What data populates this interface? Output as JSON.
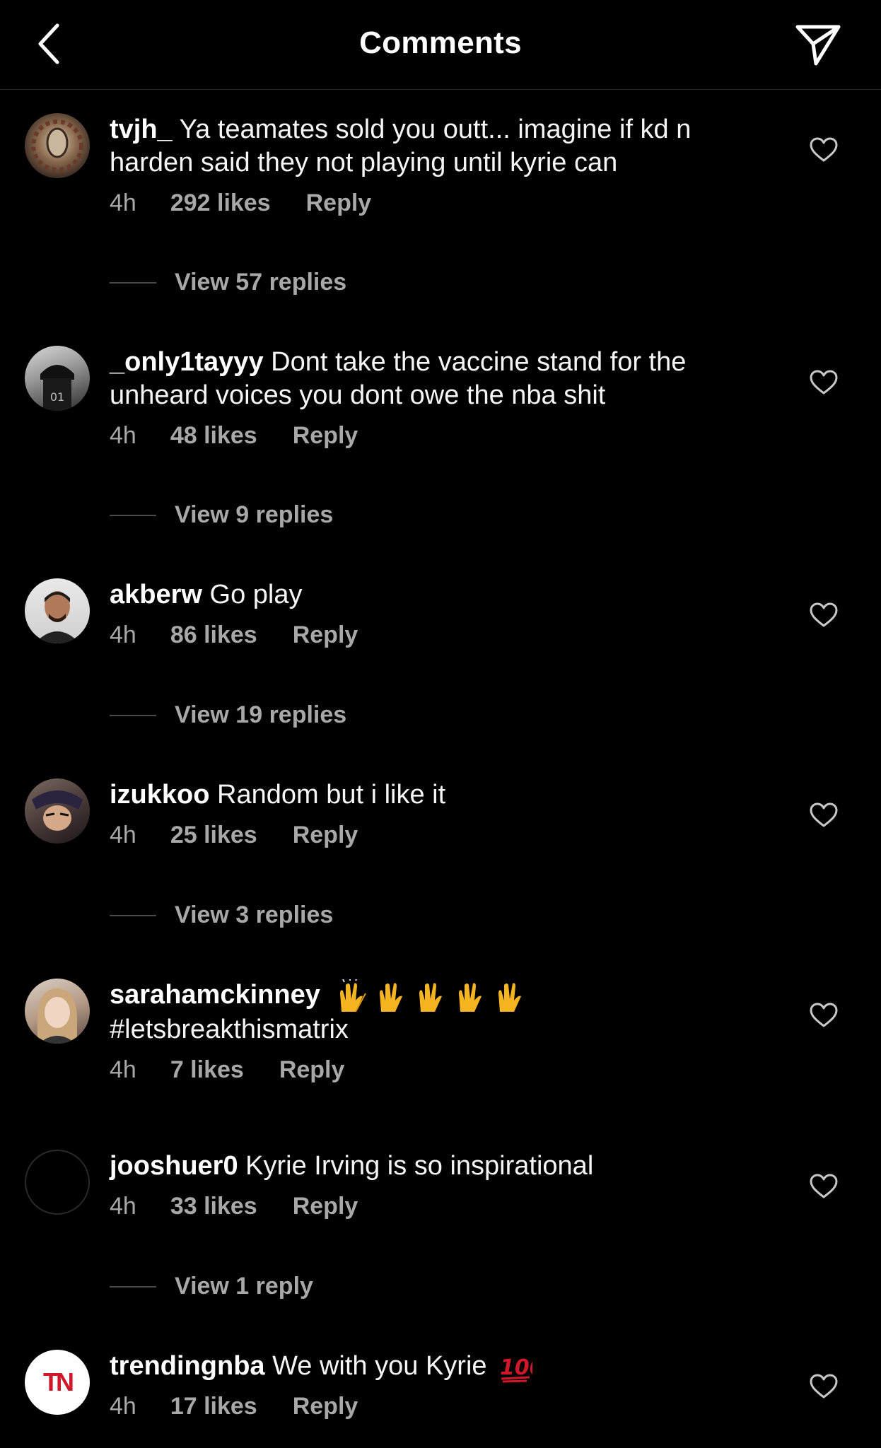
{
  "header": {
    "title": "Comments",
    "back_icon": "chevron-left-icon",
    "share_icon": "paper-plane-icon"
  },
  "colors": {
    "background": "#000000",
    "text": "#f5f5f5",
    "muted": "#a8a8a8",
    "hundred_red": "#d0182a"
  },
  "comments": [
    {
      "username": "tvjh_",
      "text": "Ya teamates sold you outt... imagine if kd n harden said they not playing until kyrie can",
      "time": "4h",
      "likes": "292 likes",
      "reply": "Reply",
      "view_replies": "View 57 replies"
    },
    {
      "username": "_only1tayyy",
      "text": "Dont take the vaccine stand for the unheard voices you dont owe the nba shit",
      "time": "4h",
      "likes": "48 likes",
      "reply": "Reply",
      "view_replies": "View 9 replies"
    },
    {
      "username": "akberw",
      "text": "Go play",
      "time": "4h",
      "likes": "86 likes",
      "reply": "Reply",
      "view_replies": "View 19 replies"
    },
    {
      "username": "izukkoo",
      "text": "Random but i like it",
      "time": "4h",
      "likes": "25 likes",
      "reply": "Reply",
      "view_replies": "View 3 replies"
    },
    {
      "username": "sarahamckinney",
      "text": "#letsbreakthismatrix",
      "emoji": "raised-hands x5",
      "time": "4h",
      "likes": "7 likes",
      "reply": "Reply"
    },
    {
      "username": "jooshuer0",
      "text": "Kyrie Irving is so inspirational",
      "time": "4h",
      "likes": "33 likes",
      "reply": "Reply",
      "view_replies": "View 1 reply"
    },
    {
      "username": "trendingnba",
      "text": "We with you Kyrie",
      "emoji": "hundred-points",
      "avatar_text": "TN",
      "time": "4h",
      "likes": "17 likes",
      "reply": "Reply"
    }
  ]
}
